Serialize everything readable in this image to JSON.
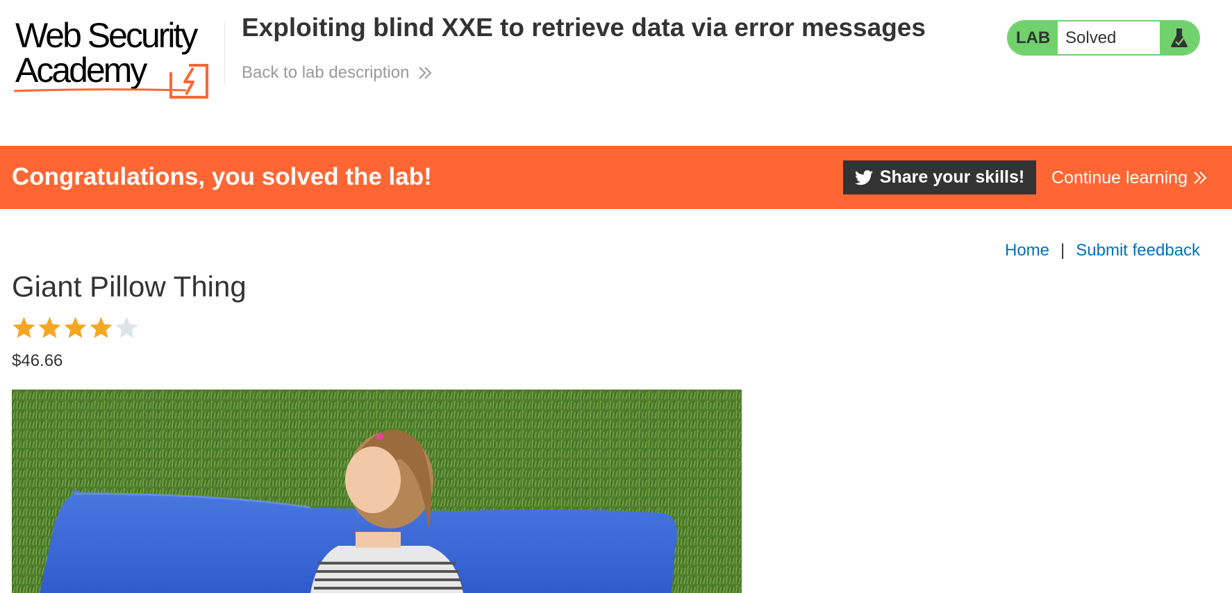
{
  "header": {
    "logo_line1": "Web Security",
    "logo_line2": "Academy",
    "lab_title": "Exploiting blind XXE to retrieve data via error messages",
    "back_link": "Back to lab description",
    "lab_status": {
      "badge": "LAB",
      "state": "Solved"
    }
  },
  "banner": {
    "message": "Congratulations, you solved the lab!",
    "share_label": "Share your skills!",
    "continue_label": "Continue learning"
  },
  "nav": {
    "home": "Home",
    "separator": "|",
    "feedback": "Submit feedback"
  },
  "product": {
    "title": "Giant Pillow Thing",
    "rating": 4,
    "rating_max": 5,
    "price": "$46.66"
  },
  "colors": {
    "brand_orange": "#ff6633",
    "lab_green": "#70d16d",
    "link_blue": "#0071bc",
    "star_filled": "#f5a623",
    "star_empty": "#dde3ea",
    "dark": "#333333"
  },
  "icons": {
    "logo_mark": "lightning-bolt-box-icon",
    "flask": "flask-icon",
    "twitter": "twitter-icon",
    "chevron": "double-chevron-right-icon",
    "star": "star-icon"
  }
}
